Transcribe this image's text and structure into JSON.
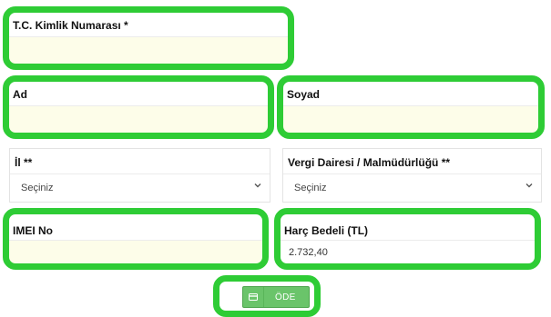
{
  "form": {
    "tc_label": "T.C. Kimlik Numarası *",
    "ad_label": "Ad",
    "soyad_label": "Soyad",
    "il_label": "İl **",
    "il_selected": "Seçiniz",
    "vergi_label": "Vergi Dairesi / Malmüdürlüğü **",
    "vergi_selected": "Seçiniz",
    "imei_label": "IMEI No",
    "harc_label": "Harç Bedeli (TL)",
    "harc_value": "2.732,40"
  },
  "actions": {
    "pay_label": "ÖDE"
  },
  "icons": {
    "pay": "credit-card-icon",
    "dropdown": "chevron-down-icon"
  },
  "colors": {
    "highlight": "#2ecc35",
    "input_bg": "#fdfde9",
    "button_bg": "#6ac46a"
  }
}
